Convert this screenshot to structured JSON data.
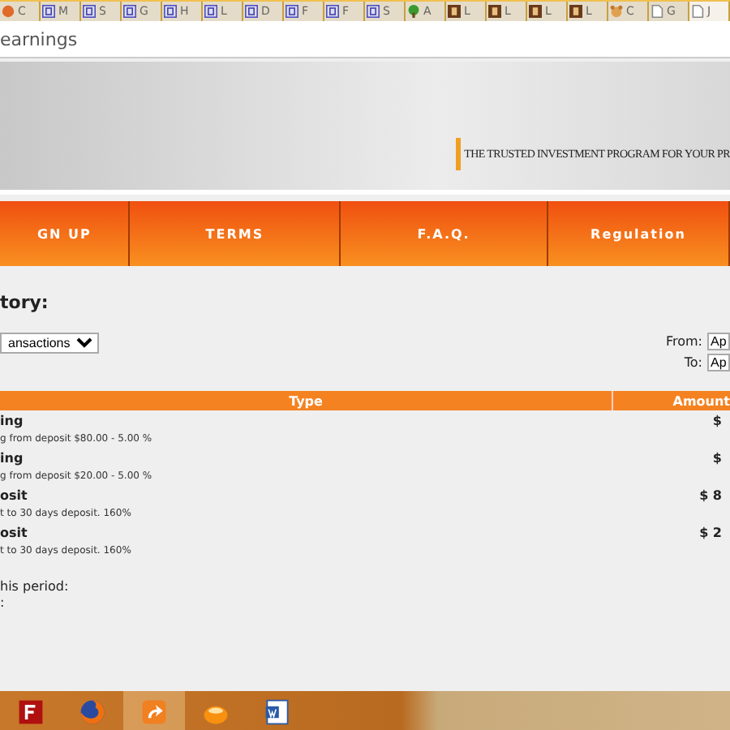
{
  "browser": {
    "tabs": [
      {
        "label": "C",
        "kind": "circle",
        "selected": false
      },
      {
        "label": "M",
        "kind": "square",
        "selected": false
      },
      {
        "label": "S",
        "kind": "square",
        "selected": false
      },
      {
        "label": "G",
        "kind": "square",
        "selected": false
      },
      {
        "label": "H",
        "kind": "square",
        "selected": false
      },
      {
        "label": "L",
        "kind": "square",
        "selected": false
      },
      {
        "label": "D",
        "kind": "square",
        "selected": false
      },
      {
        "label": "F",
        "kind": "square",
        "selected": false
      },
      {
        "label": "F",
        "kind": "square",
        "selected": false
      },
      {
        "label": "S",
        "kind": "square",
        "selected": false
      },
      {
        "label": "A",
        "kind": "tree",
        "selected": false
      },
      {
        "label": "L",
        "kind": "brown",
        "selected": false
      },
      {
        "label": "L",
        "kind": "brown",
        "selected": false
      },
      {
        "label": "L",
        "kind": "brown",
        "selected": false
      },
      {
        "label": "L",
        "kind": "brown",
        "selected": false
      },
      {
        "label": "C",
        "kind": "bear",
        "selected": false
      },
      {
        "label": "G",
        "kind": "page",
        "selected": false
      },
      {
        "label": "J",
        "kind": "page",
        "selected": true
      }
    ],
    "address": "earnings"
  },
  "banner": {
    "slogan": "THE TRUSTED INVESTMENT PROGRAM FOR YOUR PR"
  },
  "nav": [
    "GN UP",
    "TERMS",
    "F.A.Q.",
    "Regulation"
  ],
  "history": {
    "heading": "tory:",
    "filter": "ansactions",
    "from_label": "From:",
    "from_value": "Ap",
    "to_label": "To:",
    "to_value": "Ap"
  },
  "table": {
    "columns": [
      "Type",
      "Amount"
    ],
    "rows": [
      {
        "type": "ing",
        "amount": "$",
        "note": "g from deposit $80.00 - 5.00 %"
      },
      {
        "type": "ing",
        "amount": "$",
        "note": "g from deposit $20.00 - 5.00 %"
      },
      {
        "type": "osit",
        "amount": "$ 8",
        "note": "t to 30 days deposit. 160%"
      },
      {
        "type": "osit",
        "amount": "$ 2",
        "note": "t to 30 days deposit. 160%"
      }
    ]
  },
  "summary": [
    "his period:",
    ":"
  ],
  "taskbar": [
    {
      "kind": "filezilla",
      "selected": false
    },
    {
      "kind": "firefox",
      "selected": false
    },
    {
      "kind": "uc",
      "selected": true
    },
    {
      "kind": "orange",
      "selected": false
    },
    {
      "kind": "word",
      "selected": false
    }
  ]
}
